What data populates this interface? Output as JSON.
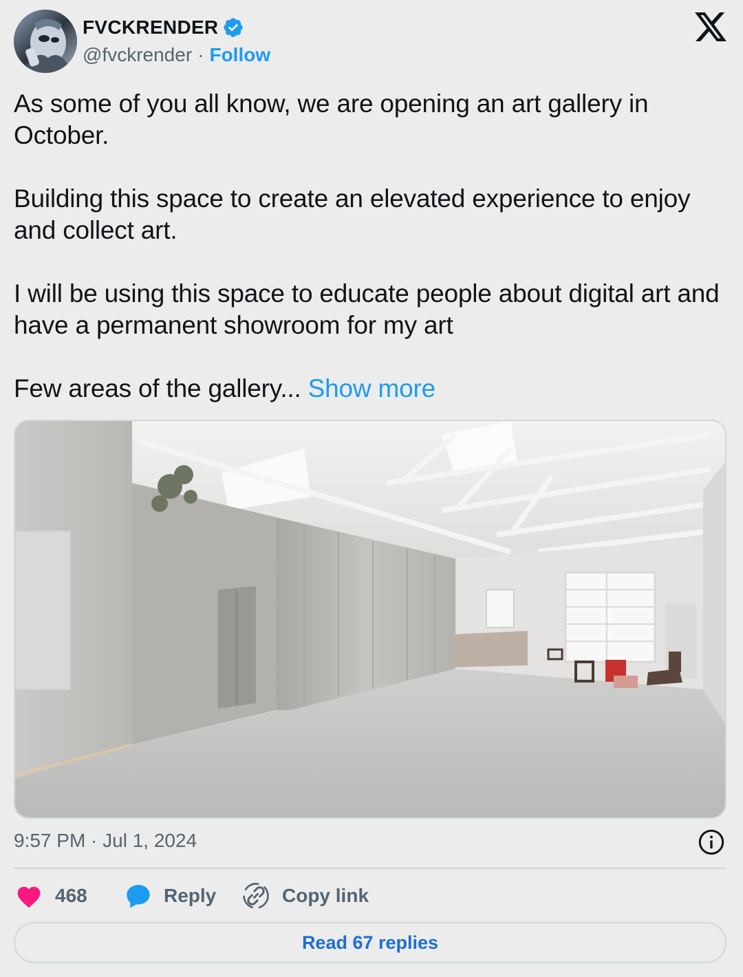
{
  "author": {
    "name": "FVCKRENDER",
    "handle": "@fvckrender",
    "separator": "·",
    "follow_label": "Follow",
    "verified_icon": "verified-badge-icon",
    "avatar_icon": "avatar-chrome-face"
  },
  "platform": {
    "logo": "x-logo-icon"
  },
  "tweet": {
    "paragraphs": [
      "As some of you all know, we are opening an art gallery in October.",
      "Building this space to create an elevated experience to enjoy and collect art.",
      "I will be using this space to educate people about digital art and have a permanent showroom for my art"
    ],
    "last_line": "Few areas of the gallery...",
    "show_more_label": "Show more"
  },
  "media": {
    "description_icon": "gallery-render-image"
  },
  "meta": {
    "timestamp": "9:57 PM · Jul 1, 2024",
    "info_icon": "info-icon"
  },
  "actions": {
    "like_count": "468",
    "reply_label": "Reply",
    "copy_link_label": "Copy link"
  },
  "read_replies_label": "Read 67 replies",
  "colors": {
    "accent": "#1d9bf0",
    "like": "#f91880",
    "muted": "#536471",
    "background": "#ececec",
    "border": "#cfd9de"
  }
}
